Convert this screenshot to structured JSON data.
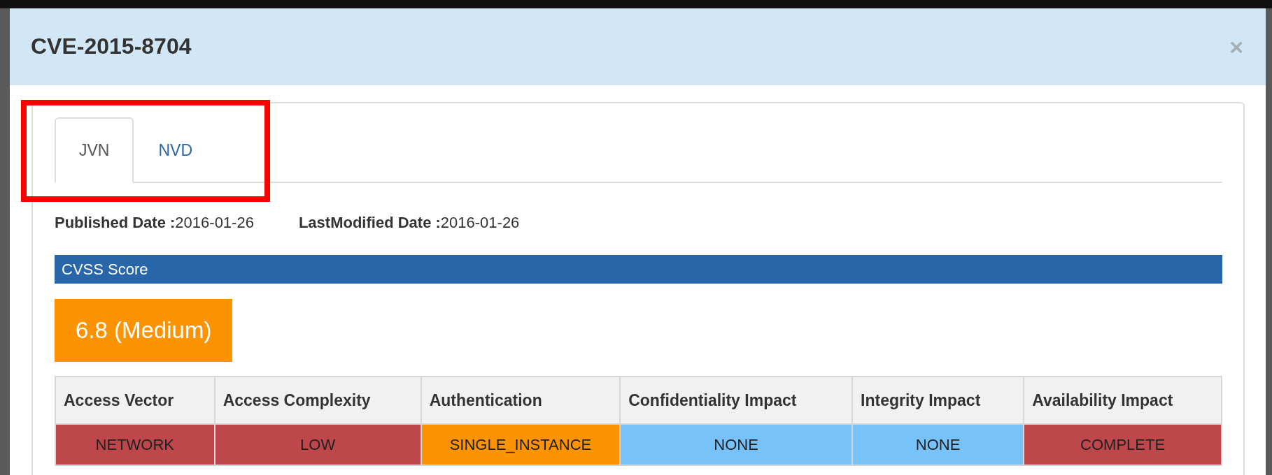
{
  "dialog": {
    "title": "CVE-2015-8704",
    "close": "×"
  },
  "tabs": [
    {
      "label": "JVN",
      "selected": true
    },
    {
      "label": "NVD",
      "selected": false
    }
  ],
  "dates": [
    {
      "label": "Published Date :",
      "value": "2016-01-26"
    },
    {
      "label": "LastModified Date :",
      "value": "2016-01-26"
    }
  ],
  "section_title": "CVSS Score",
  "score": {
    "text": "6.8 (Medium)",
    "color": "#fb9303"
  },
  "table": {
    "columns": [
      "Access Vector",
      "Access Complexity",
      "Authentication",
      "Confidentiality Impact",
      "Integrity Impact",
      "Availability Impact"
    ],
    "row": [
      {
        "text": "NETWORK",
        "color": "#be474b"
      },
      {
        "text": "LOW",
        "color": "#be474b"
      },
      {
        "text": "SINGLE_INSTANCE",
        "color": "#fb9303"
      },
      {
        "text": "NONE",
        "color": "#76c2f9"
      },
      {
        "text": "NONE",
        "color": "#76c2f9"
      },
      {
        "text": "COMPLETE",
        "color": "#be474b"
      }
    ]
  }
}
